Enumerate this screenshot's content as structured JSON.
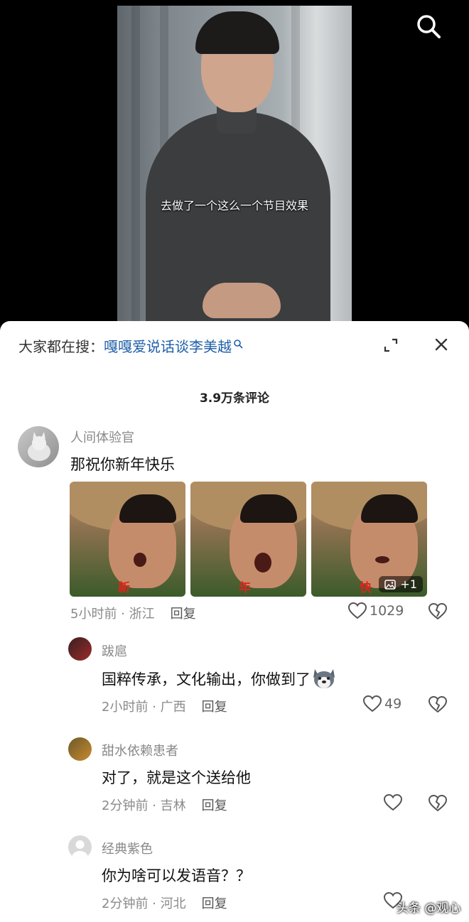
{
  "video": {
    "subtitle": "去做了一个这么一个节目效果"
  },
  "panel": {
    "search_prefix": "大家都在搜：",
    "search_keyword": "嘎嘎爱说话谈李美越",
    "comment_count": "3.9万条评论"
  },
  "comments": [
    {
      "user": "人间体验官",
      "text": "那祝你新年快乐",
      "images": [
        {
          "caption": "新"
        },
        {
          "caption": "年"
        },
        {
          "caption": "快"
        }
      ],
      "more_images": "+1",
      "time": "5小时前",
      "location": "浙江",
      "reply": "回复",
      "likes": "1029"
    },
    {
      "user": "跋扈",
      "text": "国粹传承，文化输出，你做到了",
      "time": "2小时前",
      "location": "广西",
      "reply": "回复",
      "likes": "49"
    },
    {
      "user": "甜水依赖患者",
      "text": "对了，就是这个送给他",
      "time": "2分钟前",
      "location": "吉林",
      "reply": "回复",
      "likes": ""
    },
    {
      "user": "经典紫色",
      "text": "你为啥可以发语音？？",
      "time": "2分钟前",
      "location": "河北",
      "reply": "回复",
      "likes": ""
    }
  ],
  "watermark": "头条 @观心",
  "colors": {
    "keyword": "#1f5fa8",
    "caption": "#e0231b"
  }
}
